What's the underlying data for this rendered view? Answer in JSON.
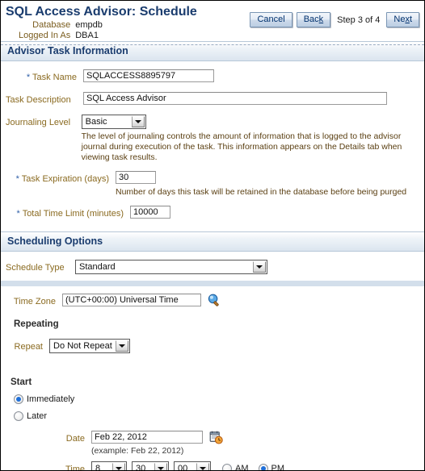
{
  "header": {
    "title": "SQL Access Advisor: Schedule",
    "identity": [
      {
        "label": "Database",
        "value": "empdb"
      },
      {
        "label": "Logged In As",
        "value": "DBA1"
      }
    ],
    "buttons": {
      "cancel": "Cancel",
      "back_prefix": "Bac",
      "back_accesskey": "k",
      "next_prefix": "Ne",
      "next_accesskey": "x",
      "next_suffix": "t"
    },
    "step_text": "Step 3 of 4"
  },
  "sections": {
    "advisor_task_information": {
      "title": "Advisor Task Information",
      "task_name": {
        "label": "Task Name",
        "required": "*",
        "value": "SQLACCESS8895797"
      },
      "task_description": {
        "label": "Task Description",
        "value": "SQL Access Advisor"
      },
      "journaling_level": {
        "label": "Journaling Level",
        "value": "Basic",
        "hint": "The level of journaling controls the amount of information that is logged to the advisor journal during execution of the task. This information appears on the Details tab when viewing task results."
      },
      "task_expiration": {
        "label": "Task Expiration (days)",
        "required": "*",
        "value": "30",
        "hint": "Number of days this task will be retained in the database before being purged"
      },
      "total_time_limit": {
        "label": "Total Time Limit (minutes)",
        "required": "*",
        "value": "10000"
      }
    },
    "scheduling_options": {
      "title": "Scheduling Options",
      "schedule_type": {
        "label": "Schedule Type",
        "value": "Standard"
      },
      "time_zone": {
        "label": "Time Zone",
        "value": "(UTC+00:00) Universal Time",
        "search_icon": "search-flashlight-icon"
      },
      "repeating": {
        "heading": "Repeating",
        "repeat": {
          "label": "Repeat",
          "value": "Do Not Repeat"
        }
      },
      "start": {
        "heading": "Start",
        "options": [
          {
            "label": "Immediately",
            "selected": true
          },
          {
            "label": "Later",
            "selected": false
          }
        ],
        "date": {
          "label": "Date",
          "value": "Feb 22, 2012",
          "example": "(example: Feb 22, 2012)",
          "picker_icon": "calendar-clock-icon"
        },
        "time": {
          "label": "Time",
          "hour": "8",
          "minute": "30",
          "second": "00",
          "meridiem": [
            {
              "label": "AM",
              "selected": false
            },
            {
              "label": "PM",
              "selected": true
            }
          ]
        }
      }
    }
  },
  "colors": {
    "title_navy": "#1a3c6e",
    "label_brown": "#8a6a20",
    "required_blue": "#2f5fa8",
    "radio_blue": "#1e6fd9",
    "band_blue": "#d3dfeb"
  }
}
